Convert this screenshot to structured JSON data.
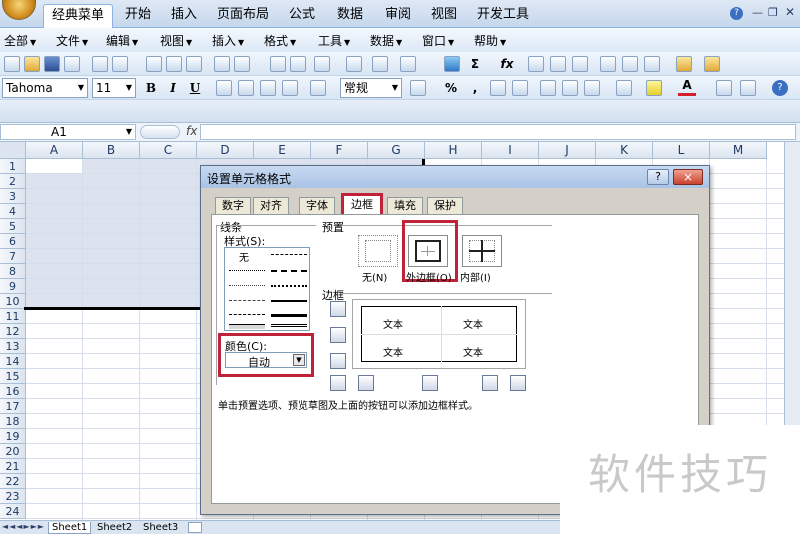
{
  "ribbon": {
    "tabs": [
      "经典菜单",
      "开始",
      "插入",
      "页面布局",
      "公式",
      "数据",
      "审阅",
      "视图",
      "开发工具"
    ],
    "active_tab": "经典菜单"
  },
  "menubar": {
    "items": [
      "全部",
      "文件",
      "编辑",
      "视图",
      "插入",
      "格式",
      "工具",
      "数据",
      "窗口",
      "帮助"
    ]
  },
  "format_toolbar": {
    "font_name": "Tahoma",
    "font_size": "11",
    "bold": "B",
    "italic": "I",
    "underline": "U",
    "number_format": "常规",
    "percent": "%",
    "comma": ","
  },
  "formula_bar": {
    "name_box": "A1",
    "fx": "fx"
  },
  "grid": {
    "columns": [
      "A",
      "B",
      "C",
      "D",
      "E",
      "F",
      "G",
      "H",
      "I",
      "J",
      "K",
      "L",
      "M"
    ],
    "rows": [
      "1",
      "2",
      "3",
      "4",
      "5",
      "6",
      "7",
      "8",
      "9",
      "10",
      "11",
      "12",
      "13",
      "14",
      "15",
      "16",
      "17",
      "18",
      "19",
      "20",
      "21",
      "22",
      "23",
      "24"
    ]
  },
  "sheets": [
    "Sheet1",
    "Sheet2",
    "Sheet3"
  ],
  "dialog": {
    "title": "设置单元格格式",
    "tabs": [
      "数字",
      "对齐",
      "字体",
      "边框",
      "填充",
      "保护"
    ],
    "active_tab": "边框",
    "line_group": "线条",
    "style_label": "样式(S):",
    "style_none": "无",
    "color_label": "颜色(C):",
    "color_value": "自动",
    "preset_group": "预置",
    "preset_none": "无(N)",
    "preset_outline": "外边框(O)",
    "preset_inside": "内部(I)",
    "border_group": "边框",
    "preview_text": "文本",
    "hint": "单击预置选项、预览草图及上面的按钮可以添加边框样式。",
    "help_btn": "?",
    "close_btn": "×"
  },
  "watermark": "软件技巧",
  "colors": {
    "highlight_red": "#c0223a",
    "selection": "#dde3ee",
    "ribbon_blue": "#c5d7ec"
  }
}
